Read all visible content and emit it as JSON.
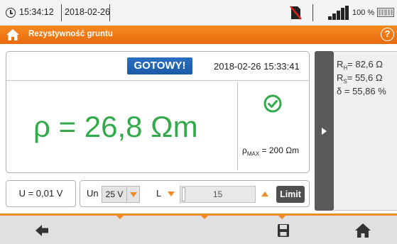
{
  "statusbar": {
    "time": "15:34:12",
    "date": "2018-02-26",
    "battery": "100 %",
    "icons": [
      "clock-icon",
      "no-sim-icon",
      "signal-icon",
      "battery-icon"
    ]
  },
  "header": {
    "title": "Rezystywność gruntu",
    "help_label": "?",
    "icons": [
      "home-icon",
      "help-icon"
    ]
  },
  "result": {
    "status_badge": "GOTOWY!",
    "datetime": "2018-02-26 15:33:41",
    "main_value": "ρ = 26,8 Ωm",
    "rho_max_symbol": "ρ",
    "rho_max_sub": "MAX",
    "rho_max_value": " = 200 Ωm"
  },
  "side_values": [
    {
      "symbol": "R",
      "sub": "H",
      "value": "= 82,6 Ω"
    },
    {
      "symbol": "R",
      "sub": "S",
      "value": "= 55,6 Ω"
    },
    {
      "symbol": "δ",
      "sub": "",
      "value": " = 55,86 %"
    }
  ],
  "controls": {
    "u_value": "U = 0,01 V",
    "un_label": "Un",
    "un_selected": "25 V",
    "l_label": "L",
    "l_value": "15",
    "limit_label": "Limit"
  },
  "toolbar": {
    "buttons": [
      "back-icon",
      "save-icon",
      "home-icon"
    ]
  },
  "colors": {
    "accent": "#f08a24",
    "result_green": "#33aa4a",
    "badge_blue": "#1a5aa8",
    "dark_button": "#505050"
  }
}
